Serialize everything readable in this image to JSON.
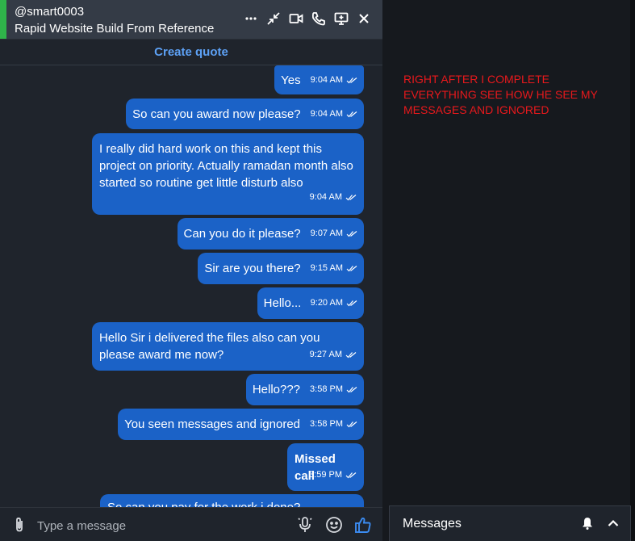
{
  "header": {
    "handle": "@smart0003",
    "project_title": "Rapid Website Build From Reference",
    "icons": [
      "more-icon",
      "minimize-icon",
      "video-call-icon",
      "phone-call-icon",
      "screen-share-icon",
      "close-icon"
    ]
  },
  "create_quote_label": "Create quote",
  "messages": [
    {
      "text": "Yes",
      "time": "9:04 AM"
    },
    {
      "text": "So can you award now please?",
      "time": "9:04 AM"
    },
    {
      "text": "I really did hard work on this and kept this project on priority. Actually ramadan month also started so routine get little disturb also",
      "time": "9:04 AM"
    },
    {
      "text": "Can you do it please?",
      "time": "9:07 AM"
    },
    {
      "text": "Sir are you there?",
      "time": "9:15 AM"
    },
    {
      "text": "Hello...",
      "time": "9:20 AM"
    },
    {
      "text": "Hello Sir i delivered the files also can you please award me now?",
      "time": "9:27 AM"
    },
    {
      "text": "Hello???",
      "time": "3:58 PM"
    },
    {
      "text": "You seen messages and ignored",
      "time": "3:58 PM"
    },
    {
      "text": "Missed call",
      "time": "3:59 PM"
    },
    {
      "text": "So can you pay for the work i done?",
      "time": ""
    }
  ],
  "composer": {
    "placeholder": "Type a message"
  },
  "annotation": "RIGHT AFTER I COMPLETE EVERYTHING SEE HOW HE SEE MY MESSAGES AND IGNORED",
  "messages_panel": {
    "title": "Messages"
  },
  "colors": {
    "bubble": "#1b62c7",
    "accent": "#5da1f5",
    "online": "#2fb34a",
    "annotation": "#e8191c"
  }
}
